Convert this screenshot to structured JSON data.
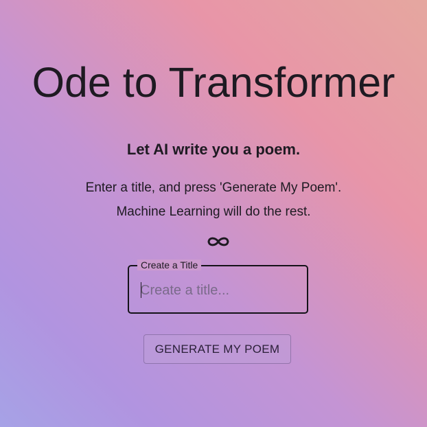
{
  "header": {
    "title": "Ode to Transformer",
    "subtitle": "Let AI write you a poem."
  },
  "intro": {
    "line1": "Enter a title, and press 'Generate My Poem'.",
    "line2": "Machine Learning will do the rest."
  },
  "divider_icon": "infinity-icon",
  "title_field": {
    "label": "Create a Title",
    "placeholder": "Create a title...",
    "value": ""
  },
  "actions": {
    "generate_label": "GENERATE MY POEM"
  }
}
